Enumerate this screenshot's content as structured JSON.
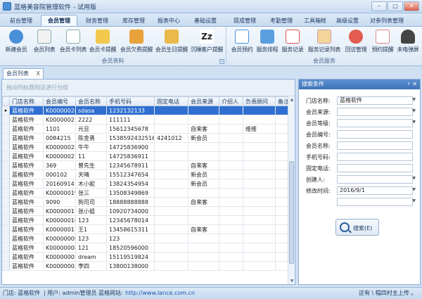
{
  "window": {
    "title": "蓝格美容院管理软件 - 试用版"
  },
  "tabs": [
    "前台管理",
    "会员管理",
    "财务管理",
    "库存管理",
    "报表中心",
    "基础设置",
    "提成管理",
    "考勤管理",
    "工具箱帐",
    "高级设置",
    "对参列表管理"
  ],
  "ribbon": {
    "group1_title": "会员资料",
    "group1_buttons": [
      "新建会员",
      "会员列表",
      "会员卡列表",
      "会员卡提醒",
      "会员欠费提醒",
      "会员生日提醒",
      "沉睡客户提醒"
    ],
    "group2_title": "会员服务",
    "group2_buttons": [
      "会员预约",
      "服务排程",
      "服务记录",
      "服务记录列表",
      "回访管理",
      "预约提醒",
      "未电弹屏"
    ]
  },
  "doc_tab": {
    "label": "会员列表",
    "close": "X"
  },
  "grid": {
    "group_hint": "拖动列标题到这进行分组",
    "columns": [
      "门店名称",
      "会员编号",
      "会员名称",
      "手机号码",
      "固定电话",
      "会员来源",
      "介绍人",
      "负责顾问",
      "备注"
    ],
    "rows": [
      [
        "蓝格软件",
        "K00000024",
        "sdasa",
        "1232132133",
        "",
        "",
        "",
        "",
        ""
      ],
      [
        "蓝格软件",
        "K00000023",
        "2222",
        "111111",
        "",
        "",
        "",
        "",
        ""
      ],
      [
        "蓝格软件",
        "1101",
        "元旦",
        "15612345678",
        "",
        "自来客",
        "",
        "维维",
        ""
      ],
      [
        "蓝格软件",
        "0084215",
        "陈金勇",
        "15385924325165",
        "4241012",
        "新会员",
        "",
        "",
        ""
      ],
      [
        "蓝格软件",
        "K00000022",
        "牛牛",
        "14725836900",
        "",
        "",
        "",
        "",
        ""
      ],
      [
        "蓝格软件",
        "K00000021",
        "11",
        "14725836911",
        "",
        "",
        "",
        "",
        ""
      ],
      [
        "蓝格软件",
        "369",
        "曾先生",
        "12345678911",
        "",
        "自来客",
        "",
        "",
        ""
      ],
      [
        "蓝格软件",
        "000102",
        "天晴",
        "15512347654",
        "",
        "新会员",
        "",
        "",
        ""
      ],
      [
        "蓝格软件",
        "20160914",
        "木小妮",
        "13824354954",
        "",
        "新会员",
        "",
        "",
        ""
      ],
      [
        "蓝格软件",
        "K00000019",
        "张三",
        "13508349869",
        "",
        "",
        "",
        "",
        ""
      ],
      [
        "蓝格软件",
        "9090",
        "狗司司",
        "18888888888",
        "",
        "自来客",
        "",
        "",
        ""
      ],
      [
        "蓝格软件",
        "K00000017",
        "张小姐",
        "10920734000",
        "",
        "",
        "",
        "",
        ""
      ],
      [
        "蓝格软件",
        "K00000016",
        "123",
        "12345678014",
        "",
        "",
        "",
        "",
        ""
      ],
      [
        "蓝格软件",
        "K00000011",
        "王1",
        "13458615311",
        "",
        "自来客",
        "",
        "",
        ""
      ],
      [
        "蓝格软件",
        "K00000009",
        "123",
        "123",
        "",
        "",
        "",
        "",
        ""
      ],
      [
        "蓝格软件",
        "K00000008",
        "121",
        "18520596000",
        "",
        "",
        "",
        "",
        ""
      ],
      [
        "蓝格软件",
        "K00000005",
        "dream",
        "15119519824",
        "",
        "",
        "",
        "",
        ""
      ],
      [
        "蓝格软件",
        "K00000003",
        "李四",
        "13800138000",
        "",
        "",
        "",
        "",
        ""
      ]
    ]
  },
  "search_panel": {
    "title": "搜索条件",
    "pin": "ᵖ",
    "close": "✕",
    "fields": [
      {
        "label": "门店名称:",
        "value": "蓝格软件"
      },
      {
        "label": "会员来源:",
        "value": ""
      },
      {
        "label": "会员等级:",
        "value": ""
      },
      {
        "label": "会员编号:",
        "value": ""
      },
      {
        "label": "会员名称:",
        "value": ""
      },
      {
        "label": "手机号码:",
        "value": ""
      },
      {
        "label": "固定电话:",
        "value": ""
      },
      {
        "label": "创建人:",
        "value": ""
      },
      {
        "label": "修改时间:",
        "value": "2016/9/1"
      },
      {
        "label": "",
        "value": ""
      }
    ],
    "search_button": "搜索(E)"
  },
  "statusbar": {
    "store": "门店: 蓝格软件",
    "user": "| 用户: admin管理员",
    "site_label": "蓝格网站:",
    "site_url": "http://www.lance.com.cn",
    "right": "这有 \\ 帽四村主上传 。"
  }
}
